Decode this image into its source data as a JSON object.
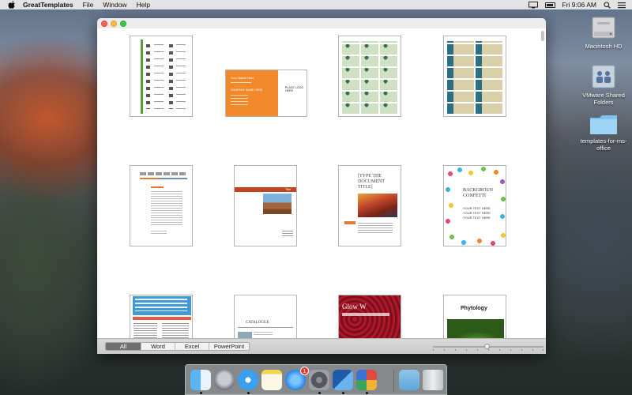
{
  "menubar": {
    "app_name": "GreatTemplates",
    "items": [
      "File",
      "Window",
      "Help"
    ],
    "clock": "Fri 9:06 AM"
  },
  "desktop_icons": [
    {
      "label": "Macintosh HD",
      "icon": "hard-drive-icon"
    },
    {
      "label": "VMware Shared Folders",
      "icon": "shared-folder-icon"
    },
    {
      "label": "templates-for-ms-office",
      "icon": "folder-icon"
    }
  ],
  "window": {
    "filter_tabs": [
      {
        "label": "All",
        "selected": true
      },
      {
        "label": "Word",
        "selected": false
      },
      {
        "label": "Excel",
        "selected": false
      },
      {
        "label": "PowerPoint",
        "selected": false
      }
    ],
    "zoom_level": 0.5
  },
  "templates": {
    "business_card": {
      "name": "Your Name Here",
      "company": "COMPANY NAME HERE",
      "logo": "PLACE LOGO HERE"
    },
    "report": {
      "title": "Title"
    },
    "document": {
      "title": "[TYPE THE DOCUMENT TITLE]"
    },
    "confetti": {
      "title": "BACKGROUN CONFETTI",
      "lines": [
        "YOUR TEXT HERE",
        "YOUR TEXT HERE",
        "YOUR TEXT HERE"
      ]
    },
    "newsletter": {
      "title": "CATALOGUE"
    },
    "glow": {
      "title": "Glow W"
    },
    "phytology": {
      "title": "Phytology"
    }
  },
  "dock": {
    "apps": [
      "Finder",
      "Launchpad",
      "Safari",
      "Notes",
      "App Store",
      "System Preferences",
      "Xcode",
      "Preview",
      "Downloads",
      "Trash"
    ],
    "appstore_badge": "1"
  }
}
